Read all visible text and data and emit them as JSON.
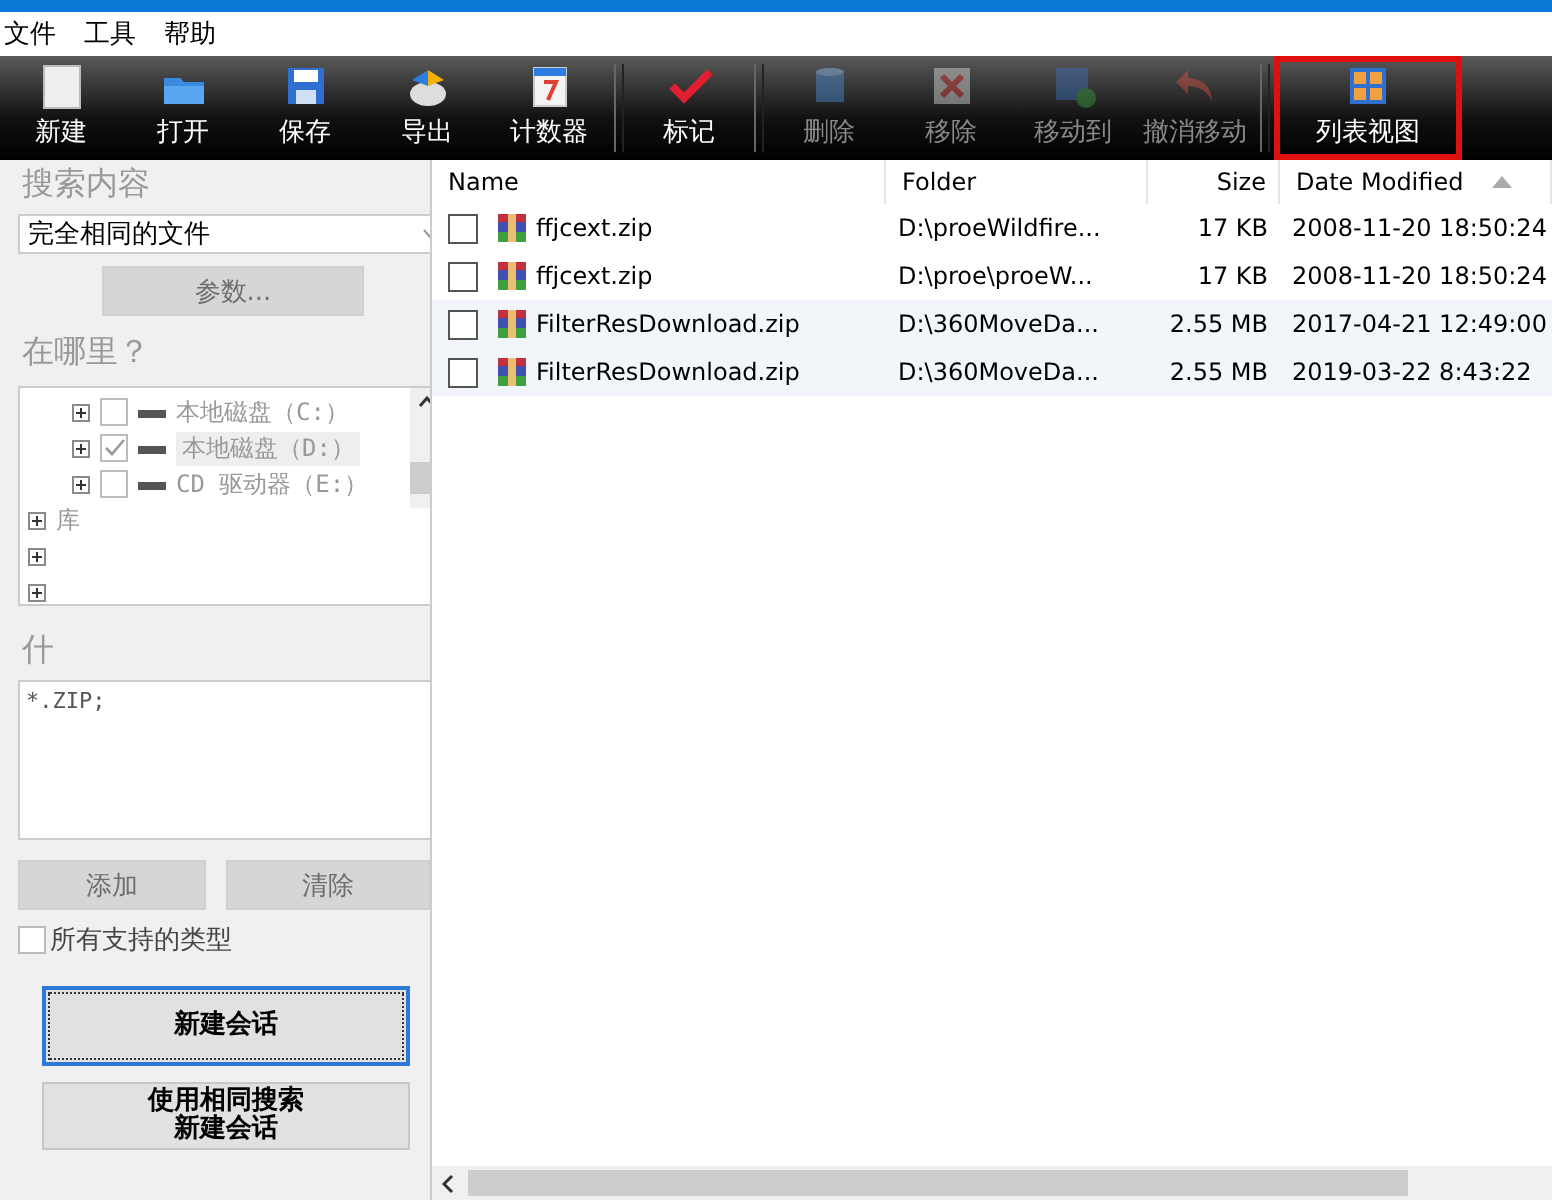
{
  "menu": [
    "文件",
    "工具",
    "帮助"
  ],
  "toolbar": [
    {
      "label": "新建",
      "disabled": false,
      "highlighted": false,
      "separator_before": false
    },
    {
      "label": "打开",
      "disabled": false,
      "highlighted": false,
      "separator_before": false
    },
    {
      "label": "保存",
      "disabled": false,
      "highlighted": false,
      "separator_before": false
    },
    {
      "label": "导出",
      "disabled": false,
      "highlighted": false,
      "separator_before": false
    },
    {
      "label": "计数器",
      "disabled": false,
      "highlighted": false,
      "separator_before": false
    },
    {
      "label": "标记",
      "disabled": false,
      "highlighted": false,
      "separator_before": true
    },
    {
      "label": "删除",
      "disabled": true,
      "highlighted": false,
      "separator_before": true
    },
    {
      "label": "移除",
      "disabled": true,
      "highlighted": false,
      "separator_before": false
    },
    {
      "label": "移动到",
      "disabled": true,
      "highlighted": false,
      "separator_before": false
    },
    {
      "label": "撤消移动",
      "disabled": true,
      "highlighted": false,
      "separator_before": false
    },
    {
      "label": "列表视图",
      "disabled": false,
      "highlighted": true,
      "separator_before": true
    }
  ],
  "sidebar": {
    "search_heading": "搜索内容",
    "search_type": "完全相同的文件",
    "params_button": {
      "label": "参数...",
      "disabled": true
    },
    "where_heading": "在哪里？",
    "tree": [
      {
        "kind": "drive",
        "label": "本地磁盘（C:）",
        "checked": false,
        "selected": false,
        "expanded": false
      },
      {
        "kind": "drive",
        "label": "本地磁盘（D:）",
        "checked": true,
        "selected": true,
        "expanded": false
      },
      {
        "kind": "drive",
        "label": "CD 驱动器（E:）",
        "checked": false,
        "selected": false,
        "expanded": false
      },
      {
        "kind": "folder",
        "label": "库",
        "expanded": false
      },
      {
        "kind": "folder",
        "expanded": false
      },
      {
        "kind": "folder",
        "expanded": false
      }
    ],
    "what_heading": "什",
    "patterns": "*.ZIP;",
    "add_button": {
      "label": "添加",
      "disabled": true
    },
    "clear_button": {
      "label": "清除",
      "disabled": true
    },
    "all_types": {
      "label": "所有支持的类型",
      "checked": false
    },
    "new_session": "新建会话",
    "new_session_same": "使用相同搜索新建会话"
  },
  "table": {
    "columns": [
      {
        "label": "Name",
        "sorted": false
      },
      {
        "label": "Folder",
        "sorted": false
      },
      {
        "label": "Size",
        "sorted": false
      },
      {
        "label": "Date Modified",
        "sorted": true
      }
    ],
    "rows": [
      {
        "name": "ffjcext.zip",
        "folder": "D:\\proeWildfire...",
        "size": "17 KB",
        "date": "2008-11-20 18:50:24",
        "checked": false,
        "shaded": false
      },
      {
        "name": "ffjcext.zip",
        "folder": "D:\\proe\\proeW...",
        "size": "17 KB",
        "date": "2008-11-20 18:50:24",
        "checked": false,
        "shaded": false
      },
      {
        "name": "FilterResDownload.zip",
        "folder": "D:\\360MoveDa...",
        "size": "2.55 MB",
        "date": "2017-04-21 12:49:00",
        "checked": false,
        "shaded": true
      },
      {
        "name": "FilterResDownload.zip",
        "folder": "D:\\360MoveDa...",
        "size": "2.55 MB",
        "date": "2019-03-22 8:43:22",
        "checked": false,
        "shaded": true
      }
    ]
  }
}
